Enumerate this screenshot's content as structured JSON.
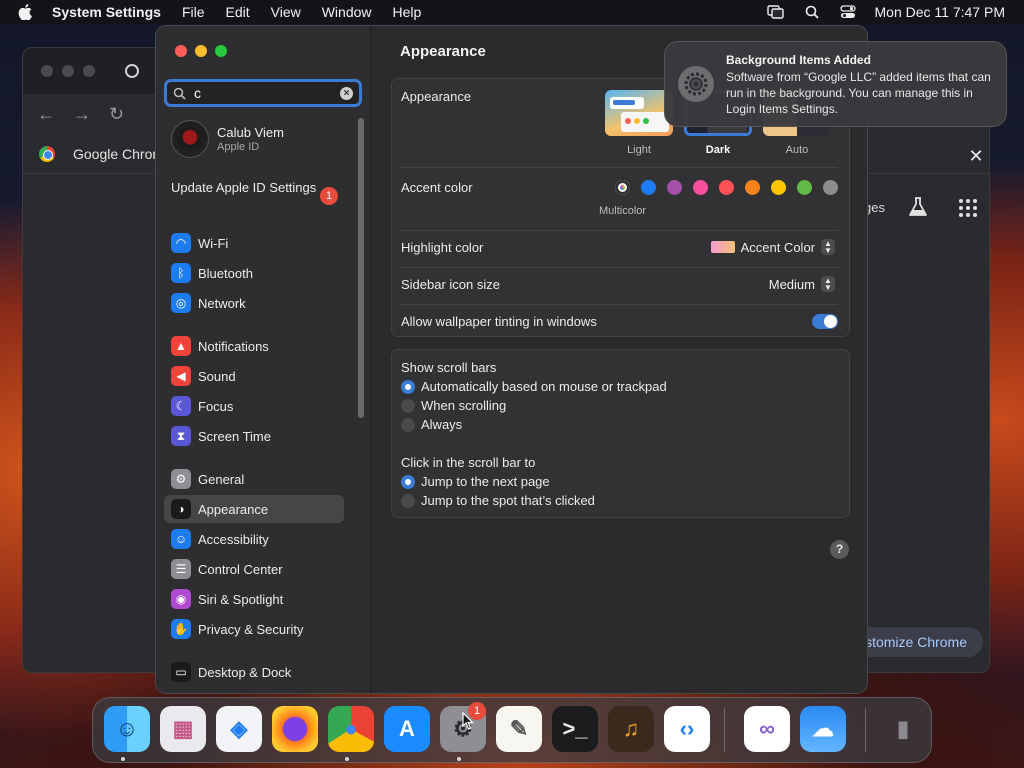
{
  "menubar": {
    "app": "System Settings",
    "items": [
      "File",
      "Edit",
      "View",
      "Window",
      "Help"
    ],
    "clock": "Mon Dec 11  7:47 PM"
  },
  "chrome_bg": {
    "bookmark_label": "Google Chrome",
    "side_text": "ges",
    "customize": "ustomize Chrome"
  },
  "settings": {
    "search_value": "c",
    "account": {
      "name": "Calub Viem",
      "sub": "Apple ID"
    },
    "update": {
      "label": "Update Apple ID Settings",
      "badge": "1"
    },
    "sidebar": [
      {
        "label": "Wi-Fi",
        "icon": "wifi-icon",
        "color": "#1e7cf2"
      },
      {
        "label": "Bluetooth",
        "icon": "bluetooth-icon",
        "color": "#1e7cf2"
      },
      {
        "label": "Network",
        "icon": "globe-icon",
        "color": "#1e7cf2"
      },
      {
        "label": "Notifications",
        "icon": "bell-icon",
        "color": "#f0443a"
      },
      {
        "label": "Sound",
        "icon": "speaker-icon",
        "color": "#f0443a"
      },
      {
        "label": "Focus",
        "icon": "moon-icon",
        "color": "#5b58d6"
      },
      {
        "label": "Screen Time",
        "icon": "hourglass-icon",
        "color": "#5b58d6"
      },
      {
        "label": "General",
        "icon": "gear-icon",
        "color": "#8e8e93"
      },
      {
        "label": "Appearance",
        "icon": "appearance-icon",
        "color": "#1a1a1a",
        "selected": true
      },
      {
        "label": "Accessibility",
        "icon": "accessibility-icon",
        "color": "#1e7cf2"
      },
      {
        "label": "Control Center",
        "icon": "control-center-icon",
        "color": "#8e8e93"
      },
      {
        "label": "Siri & Spotlight",
        "icon": "siri-icon",
        "color": "#b04ad0"
      },
      {
        "label": "Privacy & Security",
        "icon": "hand-icon",
        "color": "#1e7cf2"
      },
      {
        "label": "Desktop & Dock",
        "icon": "dock-icon",
        "color": "#1a1a1a"
      }
    ],
    "title": "Appearance",
    "appearance": {
      "label": "Appearance",
      "options": [
        "Light",
        "Dark",
        "Auto"
      ],
      "selected": "Dark"
    },
    "accent": {
      "label": "Accent color",
      "selected_name": "Multicolor",
      "colors": [
        "#c860ff",
        "#1e7cf2",
        "#a550a7",
        "#f74f9e",
        "#ff5257",
        "#f7821b",
        "#ffc600",
        "#62ba46",
        "#8c8c8c"
      ]
    },
    "highlight": {
      "label": "Highlight color",
      "value": "Accent Color"
    },
    "sidebar_icon_size": {
      "label": "Sidebar icon size",
      "value": "Medium"
    },
    "wallpaper_tinting": {
      "label": "Allow wallpaper tinting in windows",
      "on": true
    },
    "scroll_bars": {
      "label": "Show scroll bars",
      "options": [
        "Automatically based on mouse or trackpad",
        "When scrolling",
        "Always"
      ],
      "selected": 0
    },
    "click_scroll": {
      "label": "Click in the scroll bar to",
      "options": [
        "Jump to the next page",
        "Jump to the spot that’s clicked"
      ],
      "selected": 0
    },
    "help": "?"
  },
  "notification": {
    "title": "Background Items Added",
    "body": "Software from “Google LLC” added items that can run in the background. You can manage this in Login Items Settings."
  },
  "dock": {
    "apps": [
      "Finder",
      "Launchpad",
      "Safari",
      "Firefox",
      "Google Chrome",
      "App Store",
      "System Settings",
      "TextEdit",
      "Terminal",
      "GarageBand",
      "Visual Studio Code",
      "Visual Studio",
      "Weather",
      "Trash"
    ],
    "settings_badge": "1"
  }
}
